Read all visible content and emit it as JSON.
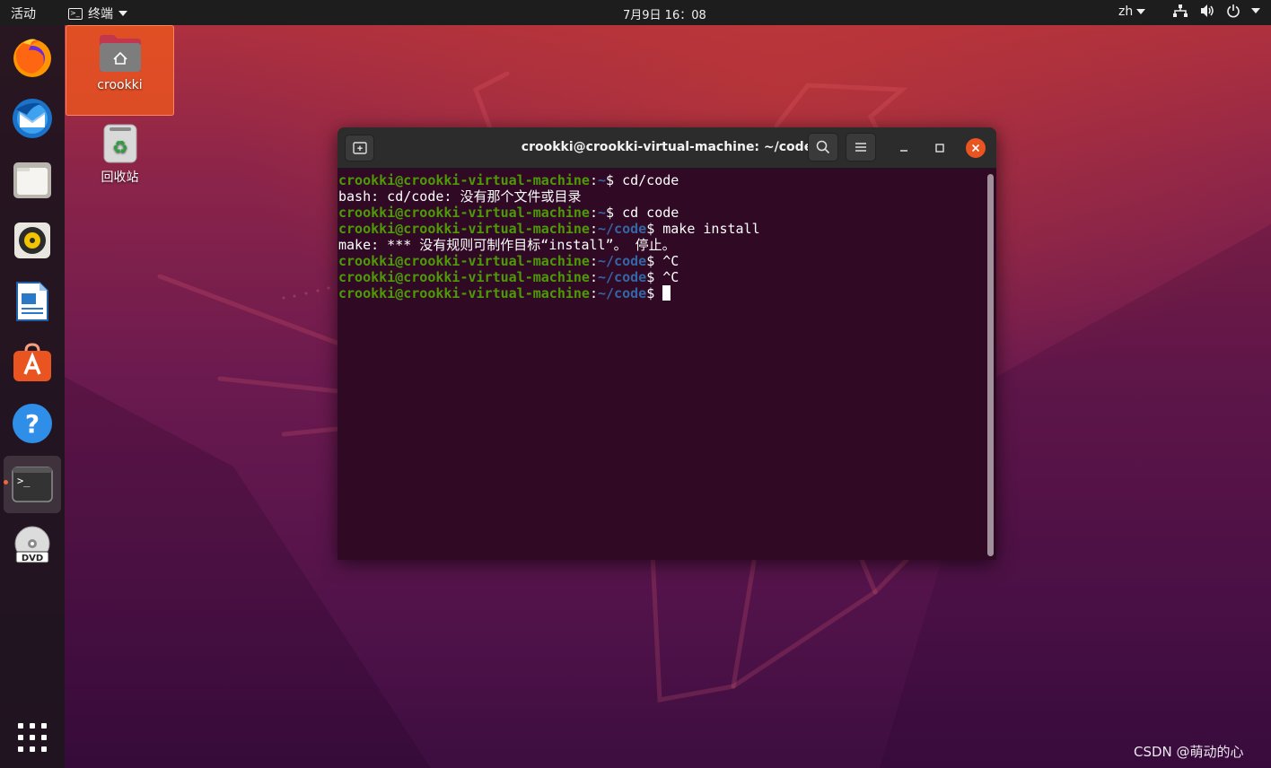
{
  "topbar": {
    "activities": "活动",
    "app_menu": "终端",
    "clock": "7月9日 16：08",
    "language": "zh",
    "icons": [
      "network-icon",
      "volume-icon",
      "power-icon",
      "system-menu-caret-icon"
    ]
  },
  "dock": {
    "items": [
      {
        "name": "firefox-icon"
      },
      {
        "name": "thunderbird-icon"
      },
      {
        "name": "files-icon"
      },
      {
        "name": "rhythmbox-icon"
      },
      {
        "name": "libreoffice-writer-icon"
      },
      {
        "name": "ubuntu-software-icon"
      },
      {
        "name": "help-icon"
      },
      {
        "name": "terminal-icon",
        "active": true
      },
      {
        "name": "dvd-icon"
      }
    ],
    "show_apps": "show-applications-icon"
  },
  "desktop": {
    "home_label": "crookki",
    "trash_label": "回收站"
  },
  "terminal": {
    "title": "crookki@crookki-virtual-machine: ~/code",
    "prompt_user": "crookki@crookki-virtual-machine",
    "lines": [
      {
        "type": "prompt",
        "path": "~",
        "cmd": " cd/code"
      },
      {
        "type": "output",
        "text": "bash: cd/code: 没有那个文件或目录"
      },
      {
        "type": "prompt",
        "path": "~",
        "cmd": " cd code"
      },
      {
        "type": "prompt",
        "path": "~/code",
        "cmd": " make install"
      },
      {
        "type": "output",
        "text": "make: *** 没有规则可制作目标“install”。 停止。"
      },
      {
        "type": "prompt",
        "path": "~/code",
        "cmd": " ^C"
      },
      {
        "type": "prompt",
        "path": "~/code",
        "cmd": " ^C"
      },
      {
        "type": "prompt",
        "path": "~/code",
        "cmd": " "
      }
    ]
  },
  "colors": {
    "accent": "#e95420",
    "terminal_bg": "#300a24",
    "prompt_green": "#4e9a06",
    "prompt_blue": "#3465a4"
  },
  "watermark": "CSDN @萌动的心"
}
